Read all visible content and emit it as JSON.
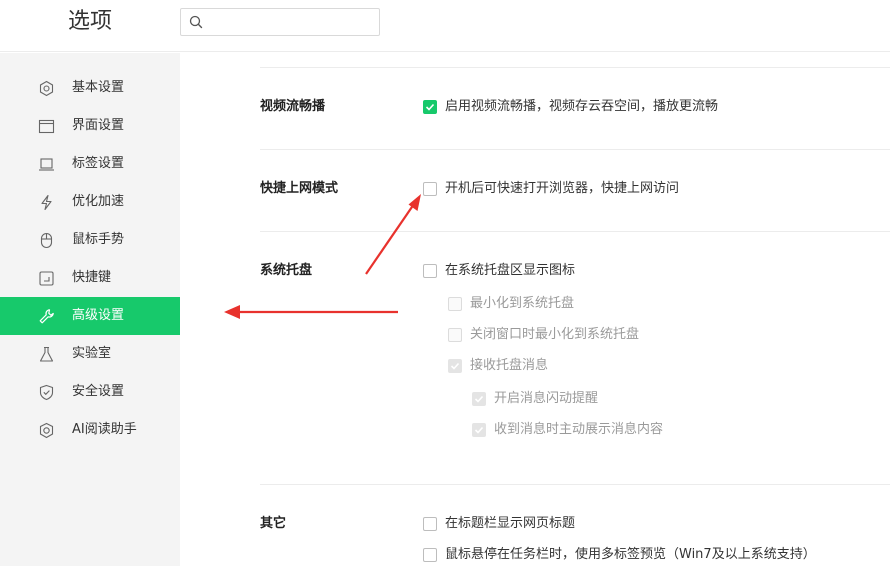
{
  "header": {
    "title": "选项",
    "search_placeholder": "",
    "search_value": ""
  },
  "sidebar": {
    "items": [
      {
        "label": "基本设置",
        "icon": "gear-icon"
      },
      {
        "label": "界面设置",
        "icon": "window-icon"
      },
      {
        "label": "标签设置",
        "icon": "tab-icon"
      },
      {
        "label": "优化加速",
        "icon": "lightning-icon"
      },
      {
        "label": "鼠标手势",
        "icon": "mouse-icon"
      },
      {
        "label": "快捷键",
        "icon": "keyboard-icon"
      },
      {
        "label": "高级设置",
        "icon": "wrench-icon",
        "active": true
      },
      {
        "label": "实验室",
        "icon": "flask-icon"
      },
      {
        "label": "安全设置",
        "icon": "shield-icon"
      },
      {
        "label": "AI阅读助手",
        "icon": "ai-assistant-icon"
      }
    ]
  },
  "sections": {
    "video": {
      "title": "视频流畅播",
      "options": [
        {
          "label": "启用视频流畅播，视频存云吞空间，播放更流畅",
          "checked": true,
          "disabled": false
        }
      ]
    },
    "quick": {
      "title": "快捷上网模式",
      "options": [
        {
          "label": "开机后可快速打开浏览器，快捷上网访问",
          "checked": false,
          "disabled": false
        }
      ]
    },
    "tray": {
      "title": "系统托盘",
      "options": [
        {
          "label": "在系统托盘区显示图标",
          "checked": false,
          "disabled": false
        },
        {
          "label": "最小化到系统托盘",
          "checked": false,
          "disabled": true
        },
        {
          "label": "关闭窗口时最小化到系统托盘",
          "checked": false,
          "disabled": true
        },
        {
          "label": "接收托盘消息",
          "checked": true,
          "disabled": true
        },
        {
          "label": "开启消息闪动提醒",
          "checked": true,
          "disabled": true
        },
        {
          "label": "收到消息时主动展示消息内容",
          "checked": true,
          "disabled": true
        }
      ]
    },
    "other": {
      "title": "其它",
      "options": [
        {
          "label": "在标题栏显示网页标题",
          "checked": false,
          "disabled": false
        },
        {
          "label": "鼠标悬停在任务栏时，使用多标签预览（Win7及以上系统支持）",
          "checked": false,
          "disabled": false
        }
      ]
    }
  },
  "colors": {
    "accent": "#17c96b",
    "annotation_arrow": "#e8322d",
    "sidebar_bg": "#f4f4f4"
  }
}
